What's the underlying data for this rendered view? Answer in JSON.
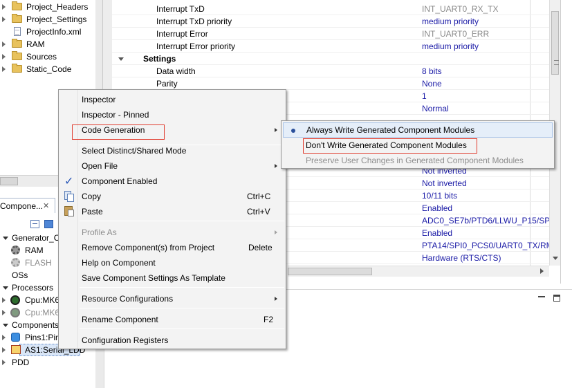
{
  "project_tree": {
    "items": [
      {
        "label": "Project_Headers",
        "icon": "folder-icon"
      },
      {
        "label": "Project_Settings",
        "icon": "folder-icon"
      },
      {
        "label": "ProjectInfo.xml",
        "icon": "file-icon"
      },
      {
        "label": "RAM",
        "icon": "folder-icon"
      },
      {
        "label": "Sources",
        "icon": "folder-icon"
      },
      {
        "label": "Static_Code",
        "icon": "folder-icon"
      }
    ]
  },
  "components_panel": {
    "tab_label": "Compone...",
    "close_glyph": "✕",
    "items": [
      {
        "label": "Generator_C"
      },
      {
        "label": "RAM"
      },
      {
        "label": "FLASH"
      },
      {
        "label": "OSs"
      },
      {
        "label": "Processors"
      },
      {
        "label": "Cpu:MK6"
      },
      {
        "label": "Cpu:MK6"
      },
      {
        "label": "Components"
      },
      {
        "label": "Pins1:Pin"
      },
      {
        "label": "AS1:Serial_LDD"
      },
      {
        "label": "PDD"
      }
    ]
  },
  "properties": {
    "rows": [
      {
        "name": "Interrupt TxD",
        "value": "INT_UART0_RX_TX",
        "value_state": "gray"
      },
      {
        "name": "Interrupt TxD priority",
        "value": "medium priority",
        "value_state": "normal"
      },
      {
        "name": "Interrupt Error",
        "value": "INT_UART0_ERR",
        "value_state": "gray"
      },
      {
        "name": "Interrupt Error priority",
        "value": "medium priority",
        "value_state": "normal"
      },
      {
        "name": "Settings",
        "value": "",
        "value_state": "section"
      },
      {
        "name": "Data width",
        "value": "8 bits",
        "value_state": "normal"
      },
      {
        "name": "Parity",
        "value": "None",
        "value_state": "normal"
      },
      {
        "name": "",
        "value": "1",
        "value_state": "normal"
      },
      {
        "name": "",
        "value": "Normal",
        "value_state": "normal"
      },
      {
        "name": "",
        "value": "Not inverted",
        "value_state": "normal"
      },
      {
        "name": "",
        "value": "Not inverted",
        "value_state": "normal"
      },
      {
        "name": "",
        "value": "10/11 bits",
        "value_state": "normal"
      },
      {
        "name": "",
        "value": "Enabled",
        "value_state": "normal"
      },
      {
        "name": "",
        "value": "ADC0_SE7b/PTD6/LLWU_P15/SPI0.",
        "value_state": "normal"
      },
      {
        "name": "",
        "value": "Enabled",
        "value_state": "normal"
      },
      {
        "name": "",
        "value": "PTA14/SPI0_PCS0/UART0_TX/RMII",
        "value_state": "normal"
      },
      {
        "name": "",
        "value": "Hardware (RTS/CTS)",
        "value_state": "normal"
      }
    ]
  },
  "context_menu": {
    "items": [
      {
        "label": "Inspector",
        "shortcut": "",
        "submenu": false,
        "disabled": false
      },
      {
        "label": "Inspector - Pinned",
        "shortcut": "",
        "submenu": false,
        "disabled": false
      },
      {
        "label": "Code Generation",
        "shortcut": "",
        "submenu": true,
        "disabled": false
      },
      {
        "label": "Select Distinct/Shared Mode",
        "shortcut": "",
        "submenu": false,
        "disabled": false
      },
      {
        "label": "Open File",
        "shortcut": "",
        "submenu": true,
        "disabled": false
      },
      {
        "label": "Component Enabled",
        "shortcut": "",
        "submenu": false,
        "disabled": false,
        "checked": true
      },
      {
        "label": "Copy",
        "shortcut": "Ctrl+C",
        "submenu": false,
        "disabled": false
      },
      {
        "label": "Paste",
        "shortcut": "Ctrl+V",
        "submenu": false,
        "disabled": false
      },
      {
        "label": "Profile As",
        "shortcut": "",
        "submenu": true,
        "disabled": true
      },
      {
        "label": "Remove Component(s) from Project",
        "shortcut": "Delete",
        "submenu": false,
        "disabled": false
      },
      {
        "label": "Help on Component",
        "shortcut": "",
        "submenu": false,
        "disabled": false
      },
      {
        "label": "Save Component Settings As Template",
        "shortcut": "",
        "submenu": false,
        "disabled": false
      },
      {
        "label": "Resource Configurations",
        "shortcut": "",
        "submenu": true,
        "disabled": false
      },
      {
        "label": "Rename Component",
        "shortcut": "F2",
        "submenu": false,
        "disabled": false
      },
      {
        "label": "Configuration Registers",
        "shortcut": "",
        "submenu": false,
        "disabled": false
      }
    ]
  },
  "code_generation_submenu": {
    "items": [
      {
        "label": "Always Write Generated Component Modules",
        "selected": true,
        "disabled": false
      },
      {
        "label": "Don't Write Generated Component Modules",
        "selected": false,
        "disabled": false
      },
      {
        "label": "Preserve User Changes in Generated Component Modules",
        "selected": false,
        "disabled": true
      }
    ]
  },
  "colors": {
    "value_text": "#1a1aa6",
    "highlight_box": "#e0392b",
    "menu_background": "#f3f3f3"
  }
}
